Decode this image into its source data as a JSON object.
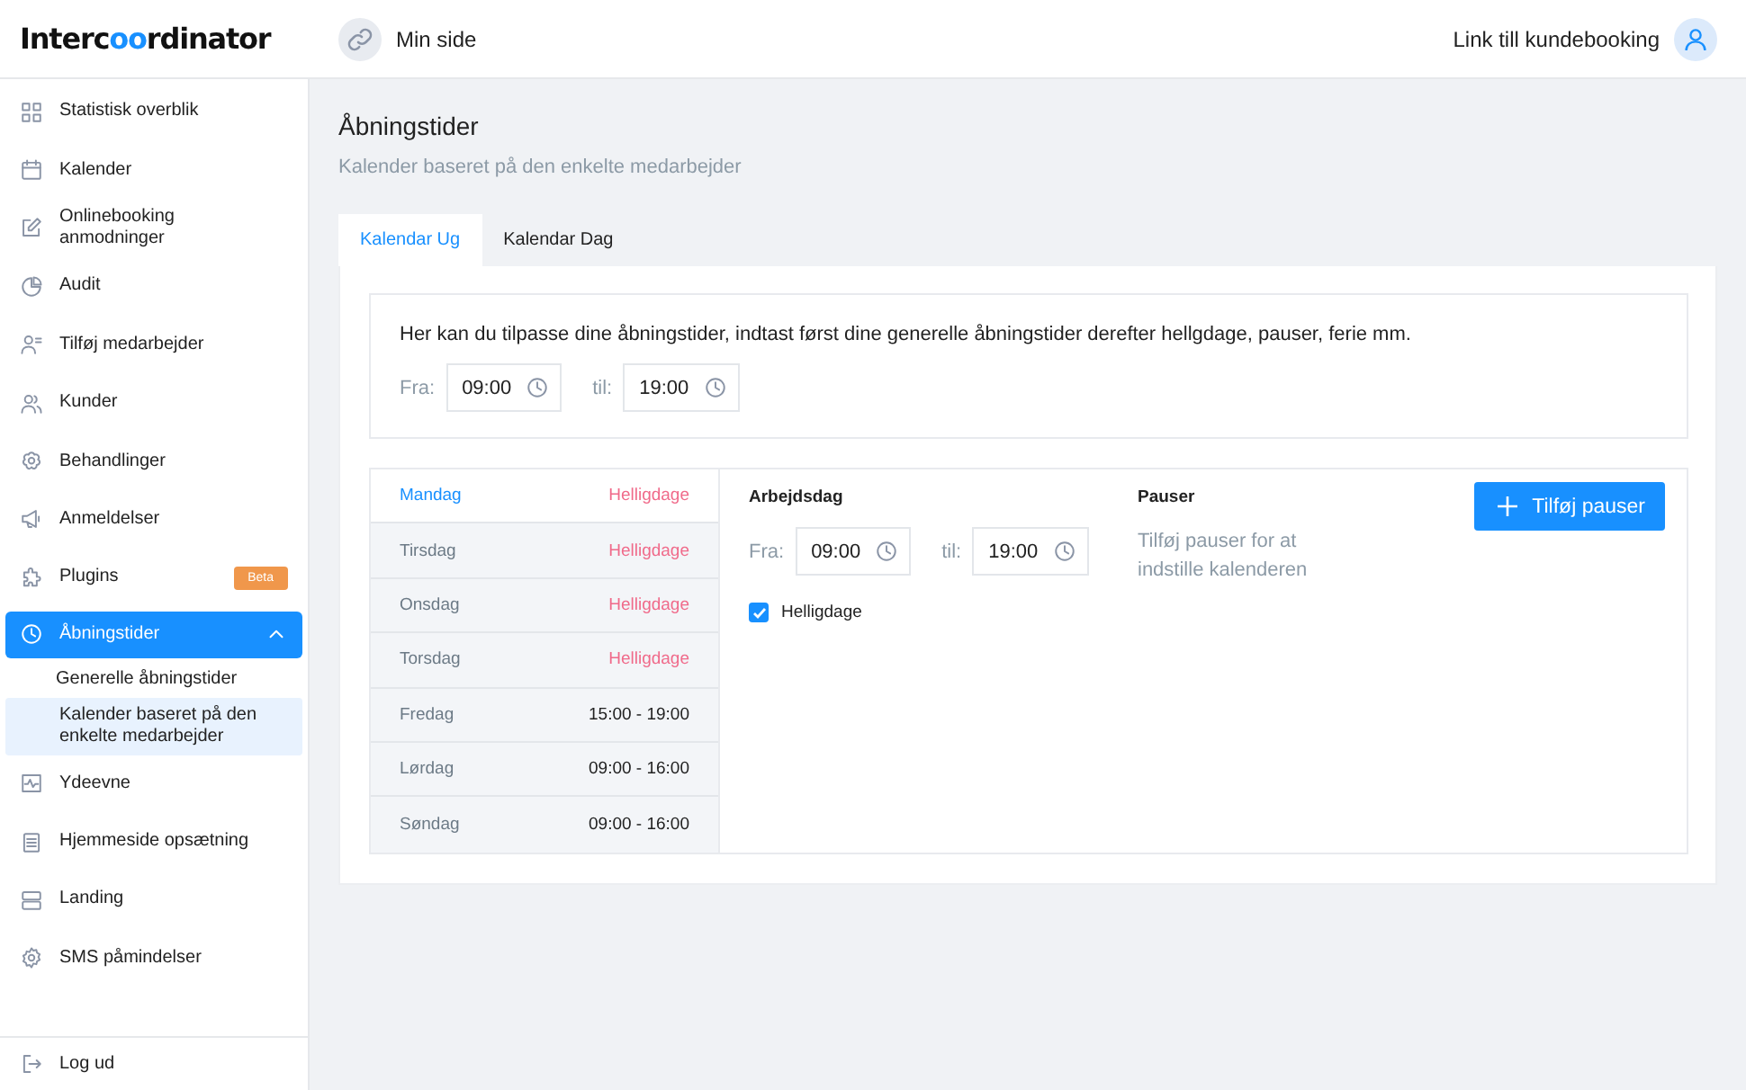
{
  "header": {
    "logo": [
      {
        "text": "Interc",
        "accent": false
      },
      {
        "text": "oo",
        "accent": true
      },
      {
        "text": "rdinator",
        "accent": false
      }
    ],
    "page_link": "Min side",
    "booking_link": "Link till kundebooking"
  },
  "sidebar": {
    "items": [
      {
        "label": "Statistisk overblik",
        "selected": false
      },
      {
        "label": "Kalender",
        "selected": false
      },
      {
        "label": "Onlinebooking anmodninger",
        "selected": false
      },
      {
        "label": "Audit",
        "selected": false
      },
      {
        "label": "Tilføj medarbejder",
        "selected": false
      },
      {
        "label": "Kunder",
        "selected": false
      },
      {
        "label": "Behandlinger",
        "selected": false
      },
      {
        "label": "Anmeldelser",
        "selected": false
      },
      {
        "label": "Plugins",
        "selected": false,
        "badge": "Beta"
      },
      {
        "label": "Åbningstider",
        "selected": true,
        "expanded": true,
        "children": [
          {
            "label": "Generelle åbningstider",
            "selected": false
          },
          {
            "label": "Kalender baseret på den enkelte medarbejder",
            "selected": true
          }
        ]
      },
      {
        "label": "Ydeevne",
        "selected": false
      },
      {
        "label": "Hjemmeside  opsætning",
        "selected": false
      },
      {
        "label": "Landing",
        "selected": false
      },
      {
        "label": "SMS påmindelser",
        "selected": false
      }
    ],
    "logout": "Log ud"
  },
  "page": {
    "title": "Åbningstider",
    "subtitle": "Kalender baseret på den enkelte medarbejder"
  },
  "tabs": [
    {
      "label": "Kalendar Ug",
      "selected": true
    },
    {
      "label": "Kalendar Dag",
      "selected": false
    }
  ],
  "general": {
    "intro": "Her kan du tilpasse dine åbningstider, indtast først dine generelle åbningstider derefter hellgdage, pauser, ferie mm.",
    "from_label": "Fra:",
    "from": "09:00",
    "to_label": "til:",
    "to": "19:00"
  },
  "days": [
    {
      "day": "Mandag",
      "value": "Helligdage",
      "kind": "holiday",
      "selected": true
    },
    {
      "day": "Tirsdag",
      "value": "Helligdage",
      "kind": "holiday",
      "selected": false
    },
    {
      "day": "Onsdag",
      "value": "Helligdage",
      "kind": "holiday",
      "selected": false
    },
    {
      "day": "Torsdag",
      "value": "Helligdage",
      "kind": "holiday",
      "selected": false
    },
    {
      "day": "Fredag",
      "value": "15:00 - 19:00",
      "kind": "hours",
      "selected": false
    },
    {
      "day": "Lørdag",
      "value": "09:00 - 16:00",
      "kind": "hours",
      "selected": false
    },
    {
      "day": "Søndag",
      "value": "09:00 - 16:00",
      "kind": "hours",
      "selected": false
    }
  ],
  "workday": {
    "title": "Arbejdsdag",
    "from_label": "Fra:",
    "from": "09:00",
    "to_label": "til:",
    "to": "19:00",
    "holiday_label": "Helligdage",
    "holiday_checked": true
  },
  "breaks": {
    "title": "Pauser",
    "empty_text": "Tilføj pauser for at indstille kalenderen",
    "add_button": "Tilføj pauser"
  }
}
